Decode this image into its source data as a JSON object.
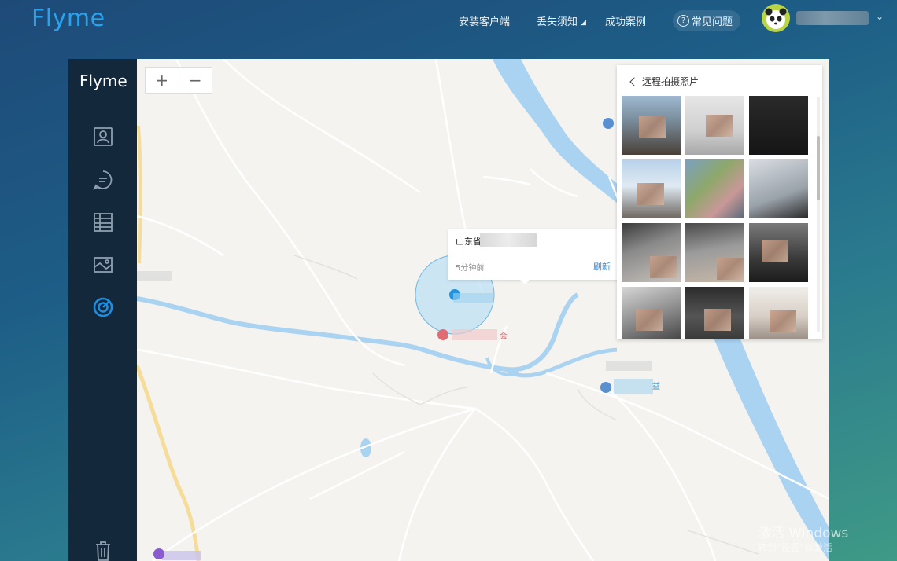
{
  "header": {
    "brand": "Flyme",
    "nav": [
      {
        "label": "安装客户端"
      },
      {
        "label": "丢失须知"
      },
      {
        "label": "成功案例"
      }
    ],
    "faq_label": "常见问题"
  },
  "sidebar": {
    "brand": "Flyme",
    "items": [
      {
        "icon": "contacts-icon",
        "active": false
      },
      {
        "icon": "message-icon",
        "active": false
      },
      {
        "icon": "table-icon",
        "active": false
      },
      {
        "icon": "gallery-icon",
        "active": false
      },
      {
        "icon": "locate-target-icon",
        "active": true
      },
      {
        "icon": "trash-icon",
        "active": false
      }
    ]
  },
  "map": {
    "zoom_in": "+",
    "zoom_out": "−",
    "location_card": {
      "province": "山东省",
      "time": "5分钟前",
      "refresh": "刷新"
    },
    "labels": {
      "place_suffix": "会",
      "place_suffix2": "益"
    }
  },
  "photos_panel": {
    "title": "远程拍摄照片",
    "count": 15
  },
  "watermark": {
    "line1": "激活 Windows",
    "line2": "转到\"设置\"以激活"
  },
  "colors": {
    "accent": "#29a3ee",
    "sidebar_bg": "#14283b",
    "active_icon": "#1e8fe0",
    "river": "#aad3f2",
    "location_circle": "#bfe0f4"
  }
}
